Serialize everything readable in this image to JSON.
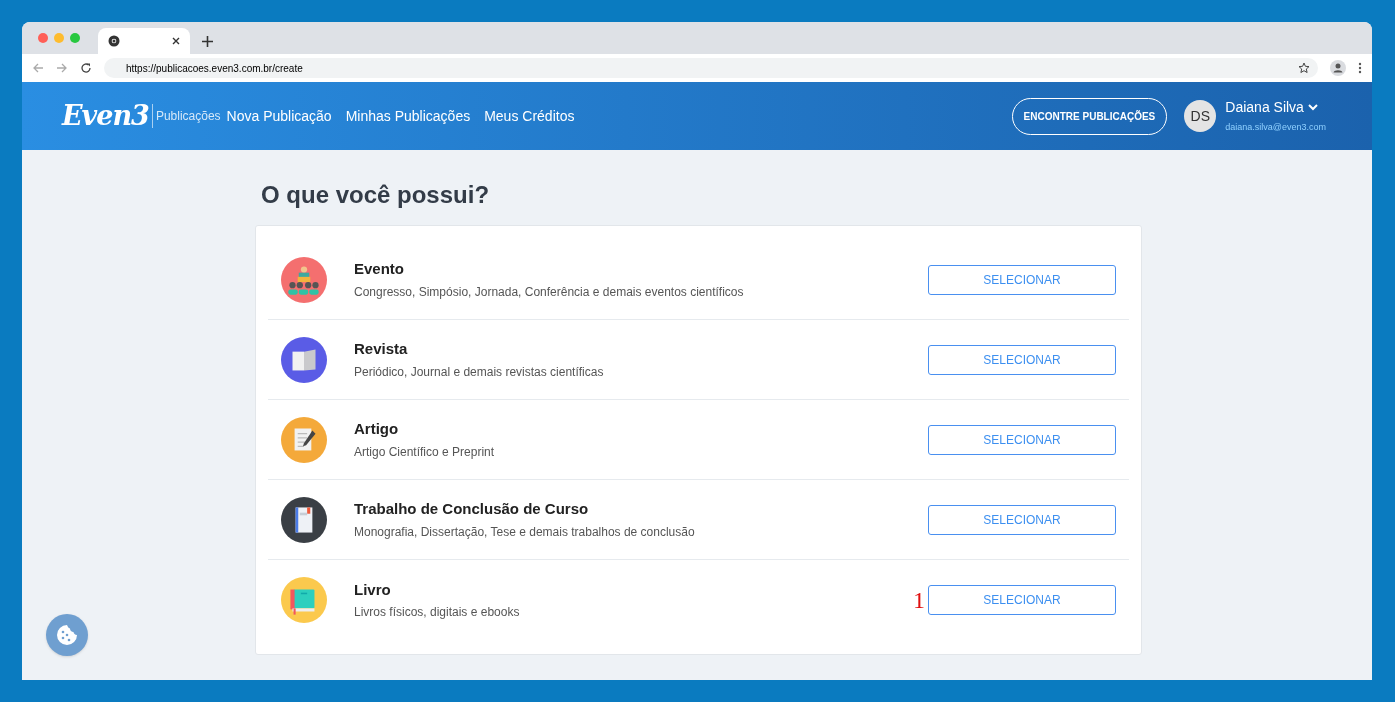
{
  "browser": {
    "url": "https://publicacoes.even3.com.br/create"
  },
  "header": {
    "logo": "Even3",
    "section": "Publicações",
    "nav": [
      "Nova Publicação",
      "Minhas Publicações",
      "Meus Créditos"
    ],
    "find_button": "ENCONTRE PUBLICAÇÕES",
    "user": {
      "initials": "DS",
      "name": "Daiana Silva",
      "email": "daiana.silva@even3.com"
    }
  },
  "page": {
    "title": "O que você possui?"
  },
  "options": [
    {
      "kind": "event",
      "title": "Evento",
      "description": "Congresso, Simpósio, Jornada, Conferência e demais eventos científicos",
      "button": "SELECIONAR"
    },
    {
      "kind": "magazine",
      "title": "Revista",
      "description": "Periódico, Journal e demais revistas científicas",
      "button": "SELECIONAR"
    },
    {
      "kind": "article",
      "title": "Artigo",
      "description": "Artigo Científico e Preprint",
      "button": "SELECIONAR"
    },
    {
      "kind": "thesis",
      "title": "Trabalho de Conclusão de Curso",
      "description": "Monografia, Dissertação, Tese e demais trabalhos de conclusão",
      "button": "SELECIONAR"
    },
    {
      "kind": "book",
      "title": "Livro",
      "description": "Livros físicos, digitais e ebooks",
      "button": "SELECIONAR",
      "annotation": "1"
    }
  ]
}
